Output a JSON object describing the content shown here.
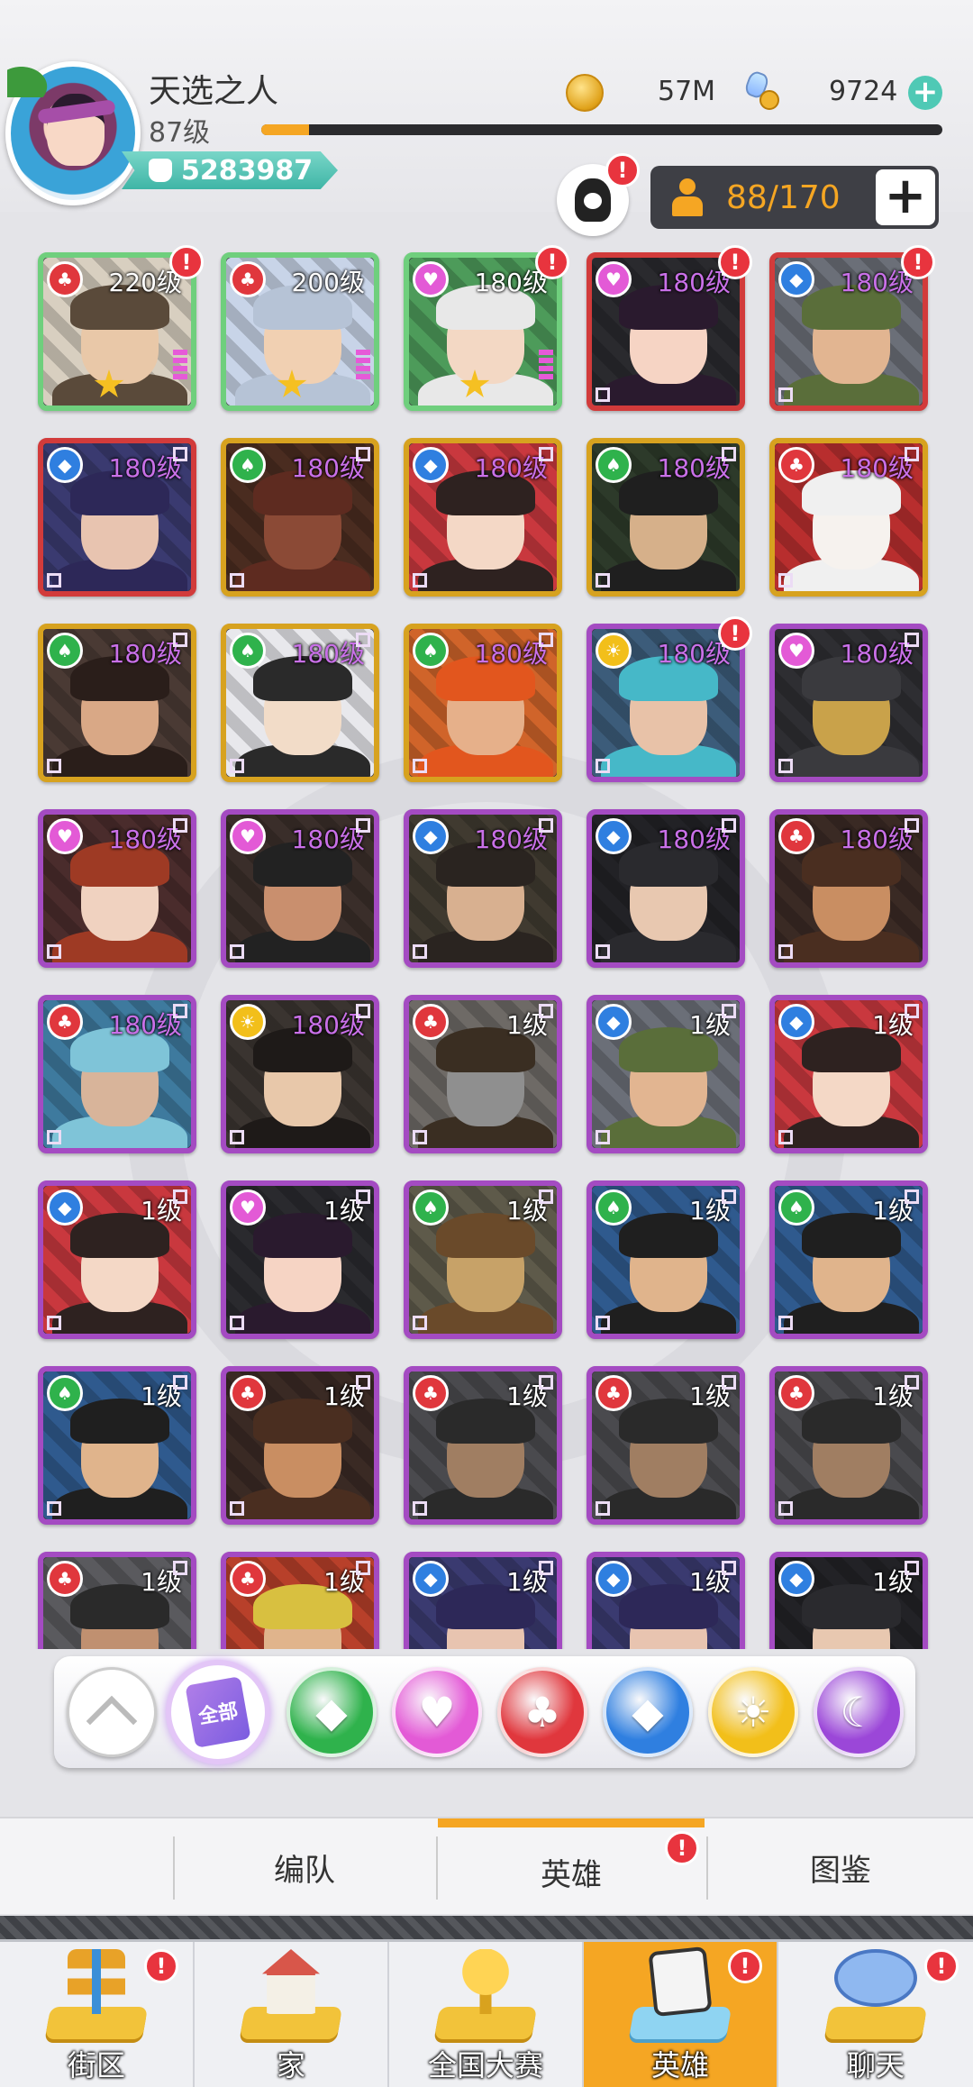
{
  "player": {
    "name": "天选之人",
    "level": "87级",
    "xp_fraction": 0.07,
    "power": "5283987"
  },
  "currency": {
    "coins": "57M",
    "gems": "9724",
    "add_symbol": "+"
  },
  "roster": {
    "capacity": "88/170",
    "add_symbol": "+",
    "alert": "!"
  },
  "heroes": [
    {
      "level": "220级",
      "rarity": "green",
      "faction": "red",
      "stars": 1,
      "alert": true,
      "palette": [
        "#d8cfc0",
        "#5a4a3a",
        "#e9c8a8"
      ]
    },
    {
      "level": "200级",
      "rarity": "silver",
      "faction": "red",
      "stars": 1,
      "alert": false,
      "palette": [
        "#c8d4e8",
        "#b6c3d6",
        "#f1d0b2"
      ]
    },
    {
      "level": "180级",
      "rarity": "green",
      "faction": "pink",
      "stars": 1,
      "alert": true,
      "palette": [
        "#4d9b5a",
        "#e8e8e8",
        "#f3d8c4"
      ]
    },
    {
      "level": "180级",
      "rarity": "red",
      "faction": "pink",
      "stars": 0,
      "alert": true,
      "palette": [
        "#2a2a2e",
        "#2a1a2e",
        "#f6d4c4"
      ]
    },
    {
      "level": "180级",
      "rarity": "red",
      "faction": "blue",
      "stars": 0,
      "alert": true,
      "palette": [
        "#6b6f78",
        "#5a6e3a",
        "#e2b591"
      ]
    },
    {
      "level": "180级",
      "rarity": "red",
      "faction": "blue",
      "stars": 0,
      "alert": false,
      "palette": [
        "#3a3a70",
        "#2d2858",
        "#e8c4b0"
      ]
    },
    {
      "level": "180级",
      "rarity": "gold",
      "faction": "green",
      "stars": 0,
      "alert": false,
      "palette": [
        "#4a2c20",
        "#5e2b20",
        "#8b4a36"
      ]
    },
    {
      "level": "180级",
      "rarity": "gold",
      "faction": "blue",
      "stars": 0,
      "alert": false,
      "palette": [
        "#c9383e",
        "#2e2220",
        "#f4d8c6"
      ]
    },
    {
      "level": "180级",
      "rarity": "gold",
      "faction": "green",
      "stars": 0,
      "alert": false,
      "palette": [
        "#2d3a2a",
        "#1f1f1f",
        "#d6b08a"
      ]
    },
    {
      "level": "180级",
      "rarity": "gold",
      "faction": "red",
      "stars": 0,
      "alert": false,
      "palette": [
        "#b82e2e",
        "#f0f0f0",
        "#f6f2ee"
      ]
    },
    {
      "level": "180级",
      "rarity": "gold",
      "faction": "green",
      "stars": 0,
      "alert": false,
      "palette": [
        "#4a3a34",
        "#2a1e1a",
        "#d9a886"
      ]
    },
    {
      "level": "180级",
      "rarity": "gold",
      "faction": "green",
      "stars": 0,
      "alert": false,
      "palette": [
        "#e8e8ec",
        "#2a2a2a",
        "#f2dcc8"
      ]
    },
    {
      "level": "180级",
      "rarity": "gold",
      "faction": "green",
      "stars": 0,
      "alert": false,
      "palette": [
        "#d0642a",
        "#e2561e",
        "#e6b08a"
      ]
    },
    {
      "level": "180级",
      "rarity": "purple",
      "faction": "gold",
      "stars": 0,
      "alert": true,
      "palette": [
        "#3c5c7a",
        "#46b8c8",
        "#e8c2a8"
      ]
    },
    {
      "level": "180级",
      "rarity": "purple",
      "faction": "pink",
      "stars": 0,
      "alert": false,
      "palette": [
        "#2e2e32",
        "#3a3a3e",
        "#c9a24a"
      ]
    },
    {
      "level": "180级",
      "rarity": "purple",
      "faction": "pink",
      "stars": 0,
      "alert": false,
      "palette": [
        "#4a2c2c",
        "#9e3a24",
        "#f0d2c0"
      ]
    },
    {
      "level": "180级",
      "rarity": "purple",
      "faction": "pink",
      "stars": 0,
      "alert": false,
      "palette": [
        "#3a2e2a",
        "#222222",
        "#c98f6e"
      ]
    },
    {
      "level": "180级",
      "rarity": "purple",
      "faction": "blue",
      "stars": 0,
      "alert": false,
      "palette": [
        "#403a30",
        "#2a2420",
        "#d8b090"
      ]
    },
    {
      "level": "180级",
      "rarity": "purple",
      "faction": "blue",
      "stars": 0,
      "alert": false,
      "palette": [
        "#222226",
        "#2a2a2e",
        "#e8c8b0"
      ]
    },
    {
      "level": "180级",
      "rarity": "purple",
      "faction": "red",
      "stars": 0,
      "alert": false,
      "palette": [
        "#3a2a24",
        "#4a2e20",
        "#c98e62"
      ]
    },
    {
      "level": "180级",
      "rarity": "purple",
      "faction": "red",
      "stars": 0,
      "alert": false,
      "palette": [
        "#3e7a9e",
        "#7fc4d8",
        "#d8b49a"
      ]
    },
    {
      "level": "180级",
      "rarity": "purple",
      "faction": "gold",
      "stars": 0,
      "alert": false,
      "palette": [
        "#3a3430",
        "#1e1a18",
        "#e8c8aa"
      ]
    },
    {
      "level": "1级",
      "rarity": "purple",
      "faction": "red",
      "stars": 0,
      "alert": false,
      "palette": [
        "#6e6a66",
        "#3a2e22",
        "#8f8f8f"
      ]
    },
    {
      "level": "1级",
      "rarity": "purple",
      "faction": "blue",
      "stars": 0,
      "alert": false,
      "palette": [
        "#6b6f78",
        "#5a6e3a",
        "#e2b591"
      ]
    },
    {
      "level": "1级",
      "rarity": "purple",
      "faction": "blue",
      "stars": 0,
      "alert": false,
      "palette": [
        "#c9383e",
        "#2e2220",
        "#f4d8c6"
      ]
    },
    {
      "level": "1级",
      "rarity": "purple",
      "faction": "blue",
      "stars": 0,
      "alert": false,
      "palette": [
        "#c9383e",
        "#2e2220",
        "#f4d8c6"
      ]
    },
    {
      "level": "1级",
      "rarity": "purple",
      "faction": "pink",
      "stars": 0,
      "alert": false,
      "palette": [
        "#2a2a2e",
        "#2a1a2e",
        "#f6d4c4"
      ]
    },
    {
      "level": "1级",
      "rarity": "purple",
      "faction": "green",
      "stars": 0,
      "alert": false,
      "palette": [
        "#5e5a4a",
        "#6a4a2a",
        "#c7a268"
      ]
    },
    {
      "level": "1级",
      "rarity": "purple",
      "faction": "green",
      "stars": 0,
      "alert": false,
      "palette": [
        "#2f5a8e",
        "#1f1f1f",
        "#e0b48c"
      ]
    },
    {
      "level": "1级",
      "rarity": "purple",
      "faction": "green",
      "stars": 0,
      "alert": false,
      "palette": [
        "#2f5a8e",
        "#1f1f1f",
        "#e0b48c"
      ]
    },
    {
      "level": "1级",
      "rarity": "purple",
      "faction": "green",
      "stars": 0,
      "alert": false,
      "palette": [
        "#2f5a8e",
        "#1f1f1f",
        "#e0b48c"
      ]
    },
    {
      "level": "1级",
      "rarity": "purple",
      "faction": "red",
      "stars": 0,
      "alert": false,
      "palette": [
        "#3a2a24",
        "#4a2e20",
        "#c98e62"
      ]
    },
    {
      "level": "1级",
      "rarity": "purple",
      "faction": "red",
      "stars": 0,
      "alert": false,
      "palette": [
        "#4a4a4e",
        "#2a2a2a",
        "#a07e62"
      ]
    },
    {
      "level": "1级",
      "rarity": "purple",
      "faction": "red",
      "stars": 0,
      "alert": false,
      "palette": [
        "#4a4a4e",
        "#2a2a2a",
        "#a07e62"
      ]
    },
    {
      "level": "1级",
      "rarity": "purple",
      "faction": "red",
      "stars": 0,
      "alert": false,
      "palette": [
        "#4a4a4e",
        "#2a2a2a",
        "#a07e62"
      ]
    },
    {
      "level": "1级",
      "rarity": "purple",
      "faction": "red",
      "stars": 0,
      "alert": false,
      "palette": [
        "#5a5a5e",
        "#2a2a2a",
        "#c09070"
      ]
    },
    {
      "level": "1级",
      "rarity": "purple",
      "faction": "red",
      "stars": 0,
      "alert": false,
      "palette": [
        "#b8402a",
        "#d8c040",
        "#e0b48c"
      ]
    },
    {
      "level": "1级",
      "rarity": "purple",
      "faction": "blue",
      "stars": 0,
      "alert": false,
      "palette": [
        "#3a3a70",
        "#2d2858",
        "#e8c4b0"
      ]
    },
    {
      "level": "1级",
      "rarity": "purple",
      "faction": "blue",
      "stars": 0,
      "alert": false,
      "palette": [
        "#3a3a70",
        "#2d2858",
        "#e8c4b0"
      ]
    },
    {
      "level": "1级",
      "rarity": "purple",
      "faction": "blue",
      "stars": 0,
      "alert": false,
      "palette": [
        "#222226",
        "#2a2a2e",
        "#e8c8b0"
      ]
    }
  ],
  "faction_filters": {
    "all_label": "全部",
    "buttons": [
      {
        "name": "collapse",
        "color": "#ffffff"
      },
      {
        "name": "all",
        "color": "#ffffff"
      },
      {
        "name": "green",
        "color": "#2fb24c"
      },
      {
        "name": "pink",
        "color": "#e35ad6"
      },
      {
        "name": "red",
        "color": "#e0373d"
      },
      {
        "name": "blue",
        "color": "#2f7fe0"
      },
      {
        "name": "gold",
        "color": "#f2bf1a"
      },
      {
        "name": "purple",
        "color": "#9b47d8"
      }
    ]
  },
  "faction_colors": {
    "red": "#e0373d",
    "pink": "#e35ad6",
    "blue": "#2f7fe0",
    "green": "#2fb24c",
    "gold": "#f2bf1a"
  },
  "sub_tabs": [
    {
      "label": "编队",
      "active": false
    },
    {
      "label": "英雄",
      "active": true,
      "alert": "!"
    },
    {
      "label": "图鉴",
      "active": false
    }
  ],
  "bottom_nav": [
    {
      "label": "街区",
      "icon": "signpost-icon",
      "alert": "!"
    },
    {
      "label": "家",
      "icon": "house-icon"
    },
    {
      "label": "全国大赛",
      "icon": "trophy-icon"
    },
    {
      "label": "英雄",
      "icon": "hero-cards-icon",
      "active": true,
      "alert": "!"
    },
    {
      "label": "聊天",
      "icon": "chat-bubble-icon",
      "alert": "!"
    }
  ]
}
